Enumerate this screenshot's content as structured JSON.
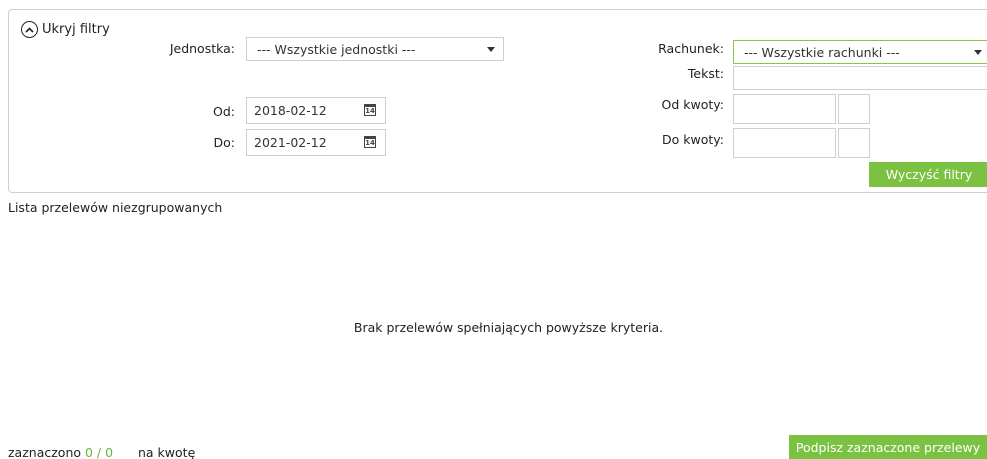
{
  "filters": {
    "toggle_label": "Ukryj filtry",
    "jednostka_label": "Jednostka:",
    "jednostka_value": "--- Wszystkie jednostki ---",
    "od_label": "Od:",
    "od_value": "2018-02-12",
    "do_label": "Do:",
    "do_value": "2021-02-12",
    "rachunek_label": "Rachunek:",
    "rachunek_value": "--- Wszystkie rachunki ---",
    "tekst_label": "Tekst:",
    "tekst_value": "",
    "od_kwoty_label": "Od kwoty:",
    "do_kwoty_label": "Do kwoty:",
    "clear_button": "Wyczyść filtry",
    "calendar_glyph": "14"
  },
  "list": {
    "title": "Lista przelewów niezgrupowanych",
    "empty_message": "Brak przelewów spełniających powyższe kryteria."
  },
  "footer": {
    "selected_label": "zaznaczono",
    "selected_count": "0 / 0",
    "amount_label": "na kwotę",
    "sign_button": "Podpisz zaznaczone przelewy"
  },
  "colors": {
    "accent": "#7cc242",
    "border": "#cfcfcf"
  }
}
